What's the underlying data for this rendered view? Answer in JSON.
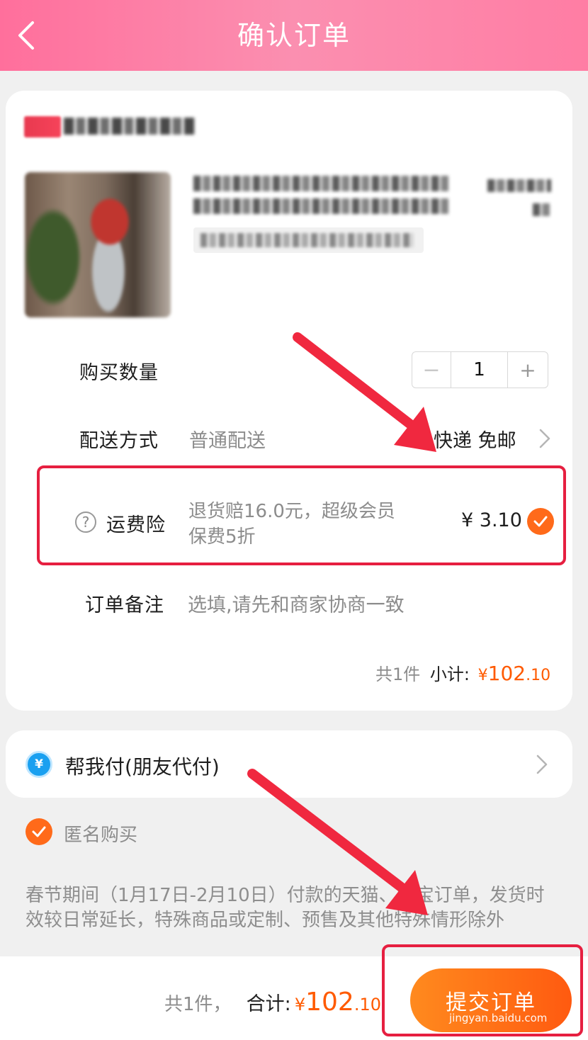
{
  "header": {
    "back_icon": "chevron-left-icon",
    "title": "确认订单"
  },
  "order": {
    "quantity_label": "购买数量",
    "quantity_value": "1",
    "minus_glyph": "−",
    "plus_glyph": "+",
    "delivery_label": "配送方式",
    "delivery_type": "普通配送",
    "delivery_value": "快递 免邮",
    "insurance_label": "运费险",
    "insurance_desc_line1": "退货赔16.0元，超级会员",
    "insurance_desc_line2": "保费5折",
    "insurance_price": "¥ 3.10",
    "note_label": "订单备注",
    "note_placeholder": "选填,请先和商家协商一致",
    "subtotal_count": "共1件",
    "subtotal_label": "小计:",
    "subtotal_yen": "¥",
    "subtotal_int": "102",
    "subtotal_dec": ".10"
  },
  "pay_friend": {
    "icon_glyph": "¥",
    "label": "帮我付(朋友代付)"
  },
  "anonymous": {
    "label": "匿名购买",
    "checked": true
  },
  "notice": "春节期间（1月17日-2月10日）付款的天猫、淘宝订单，发货时效较日常延长，特殊商品或定制、预售及其他特殊情形除外",
  "footer": {
    "count": "共1件，",
    "total_label": "合计:",
    "total_yen": "¥",
    "total_int": "102",
    "total_dec": ".10",
    "submit_label": "提交订单",
    "watermark": "jingyan.baidu.com"
  },
  "colors": {
    "header_pink": "#ff7da4",
    "accent_orange": "#ff6a1a",
    "highlight_red": "#e61f40"
  }
}
